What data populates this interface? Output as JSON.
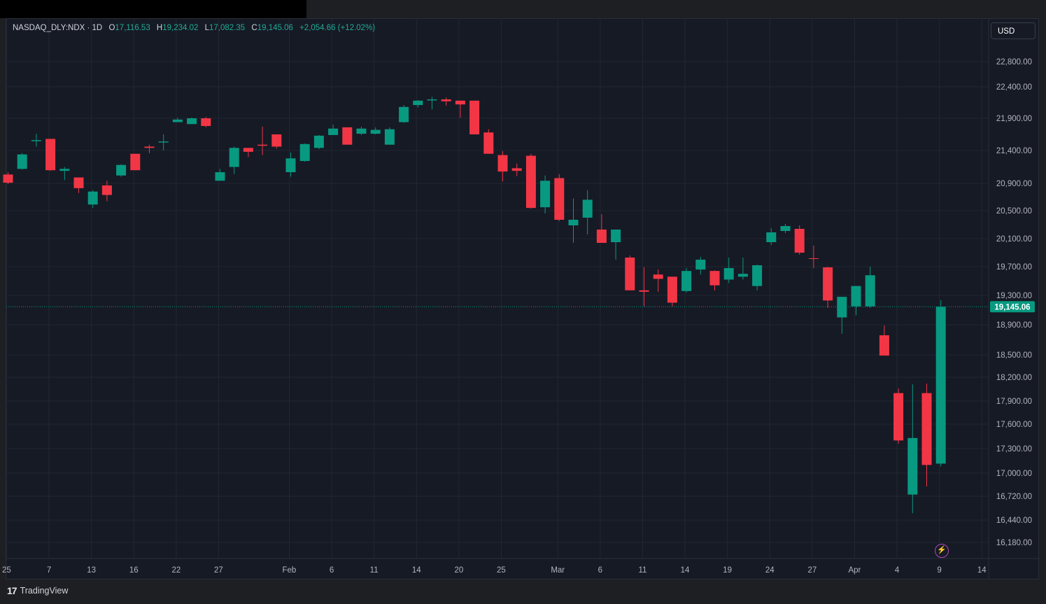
{
  "legend": {
    "symbol": "NASDAQ_DLY:NDX · 1D",
    "open_label": "O",
    "open": "17,116.53",
    "high_label": "H",
    "high": "19,234.02",
    "low_label": "L",
    "low": "17,082.35",
    "close_label": "C",
    "close": "19,145.06",
    "change": "+2,054.66 (+12.02%)"
  },
  "currency_button": "USD",
  "footer": {
    "brand": "TradingView",
    "logo_glyph": "17"
  },
  "colors": {
    "up": "#089981",
    "down": "#f23645",
    "last_price": "#089981",
    "background": "#161a25"
  },
  "icons": {
    "flash": "lightning-icon"
  },
  "flash_glyph": "⚡",
  "chart_data": {
    "type": "candlestick",
    "last_price_label": "19,145.06",
    "last_price": 19145.06,
    "y_ticks": [
      {
        "v": 22800,
        "l": "22,800.00"
      },
      {
        "v": 22400,
        "l": "22,400.00"
      },
      {
        "v": 21900,
        "l": "21,900.00"
      },
      {
        "v": 21400,
        "l": "21,400.00"
      },
      {
        "v": 20900,
        "l": "20,900.00"
      },
      {
        "v": 20500,
        "l": "20,500.00"
      },
      {
        "v": 20100,
        "l": "20,100.00"
      },
      {
        "v": 19700,
        "l": "19,700.00"
      },
      {
        "v": 19300,
        "l": "19,300.00"
      },
      {
        "v": 18900,
        "l": "18,900.00"
      },
      {
        "v": 18500,
        "l": "18,500.00"
      },
      {
        "v": 18200,
        "l": "18,200.00"
      },
      {
        "v": 17900,
        "l": "17,900.00"
      },
      {
        "v": 17600,
        "l": "17,600.00"
      },
      {
        "v": 17300,
        "l": "17,300.00"
      },
      {
        "v": 17000,
        "l": "17,000.00"
      },
      {
        "v": 16720,
        "l": "16,720.00"
      },
      {
        "v": 16440,
        "l": "16,440.00"
      },
      {
        "v": 16180,
        "l": "16,180.00"
      }
    ],
    "x_ticks": [
      {
        "i": -0.3,
        "l": "25"
      },
      {
        "i": 2.7,
        "l": "7"
      },
      {
        "i": 5.7,
        "l": "13"
      },
      {
        "i": 8.7,
        "l": "16"
      },
      {
        "i": 11.7,
        "l": "22"
      },
      {
        "i": 14.7,
        "l": "27"
      },
      {
        "i": 19.7,
        "l": "Feb"
      },
      {
        "i": 22.7,
        "l": "6"
      },
      {
        "i": 25.7,
        "l": "11"
      },
      {
        "i": 28.7,
        "l": "14"
      },
      {
        "i": 31.7,
        "l": "20"
      },
      {
        "i": 34.7,
        "l": "25"
      },
      {
        "i": 38.7,
        "l": "Mar"
      },
      {
        "i": 41.7,
        "l": "6"
      },
      {
        "i": 44.7,
        "l": "11"
      },
      {
        "i": 47.7,
        "l": "14"
      },
      {
        "i": 50.7,
        "l": "19"
      },
      {
        "i": 53.7,
        "l": "24"
      },
      {
        "i": 56.7,
        "l": "27"
      },
      {
        "i": 59.7,
        "l": "Apr"
      },
      {
        "i": 62.7,
        "l": "4"
      },
      {
        "i": 65.7,
        "l": "9"
      },
      {
        "i": 68.7,
        "l": "14"
      }
    ],
    "candles": [
      {
        "o": 21035,
        "h": 21070,
        "l": 20890,
        "c": 20910
      },
      {
        "o": 21120,
        "h": 21360,
        "l": 21110,
        "c": 21340
      },
      {
        "o": 21555,
        "h": 21660,
        "l": 21460,
        "c": 21560
      },
      {
        "o": 21580,
        "h": 21580,
        "l": 21090,
        "c": 21100
      },
      {
        "o": 21090,
        "h": 21150,
        "l": 20950,
        "c": 21120
      },
      {
        "o": 20990,
        "h": 20990,
        "l": 20760,
        "c": 20830
      },
      {
        "o": 20590,
        "h": 20800,
        "l": 20540,
        "c": 20780
      },
      {
        "o": 20870,
        "h": 20940,
        "l": 20640,
        "c": 20730
      },
      {
        "o": 21020,
        "h": 21190,
        "l": 21000,
        "c": 21180
      },
      {
        "o": 21350,
        "h": 21350,
        "l": 21100,
        "c": 21100
      },
      {
        "o": 21460,
        "h": 21490,
        "l": 21360,
        "c": 21440
      },
      {
        "o": 21540,
        "h": 21650,
        "l": 21400,
        "c": 21540
      },
      {
        "o": 21840,
        "h": 21910,
        "l": 21840,
        "c": 21880
      },
      {
        "o": 21810,
        "h": 21910,
        "l": 21810,
        "c": 21900
      },
      {
        "o": 21900,
        "h": 21920,
        "l": 21760,
        "c": 21780
      },
      {
        "o": 20940,
        "h": 21120,
        "l": 20940,
        "c": 21070
      },
      {
        "o": 21150,
        "h": 21460,
        "l": 21040,
        "c": 21440
      },
      {
        "o": 21440,
        "h": 21440,
        "l": 21300,
        "c": 21380
      },
      {
        "o": 21490,
        "h": 21770,
        "l": 21330,
        "c": 21480
      },
      {
        "o": 21650,
        "h": 21650,
        "l": 21430,
        "c": 21460
      },
      {
        "o": 21070,
        "h": 21370,
        "l": 21000,
        "c": 21280
      },
      {
        "o": 21240,
        "h": 21510,
        "l": 21230,
        "c": 21500
      },
      {
        "o": 21440,
        "h": 21640,
        "l": 21420,
        "c": 21630
      },
      {
        "o": 21640,
        "h": 21800,
        "l": 21640,
        "c": 21740
      },
      {
        "o": 21760,
        "h": 21760,
        "l": 21490,
        "c": 21490
      },
      {
        "o": 21660,
        "h": 21770,
        "l": 21640,
        "c": 21740
      },
      {
        "o": 21660,
        "h": 21760,
        "l": 21650,
        "c": 21720
      },
      {
        "o": 21490,
        "h": 21760,
        "l": 21490,
        "c": 21730
      },
      {
        "o": 21840,
        "h": 22110,
        "l": 21830,
        "c": 22080
      },
      {
        "o": 22110,
        "h": 22190,
        "l": 22070,
        "c": 22180
      },
      {
        "o": 22200,
        "h": 22240,
        "l": 22040,
        "c": 22200
      },
      {
        "o": 22200,
        "h": 22230,
        "l": 22100,
        "c": 22170
      },
      {
        "o": 22180,
        "h": 22180,
        "l": 21910,
        "c": 22120
      },
      {
        "o": 22180,
        "h": 22180,
        "l": 21650,
        "c": 21650
      },
      {
        "o": 21680,
        "h": 21730,
        "l": 21380,
        "c": 21350
      },
      {
        "o": 21330,
        "h": 21390,
        "l": 20930,
        "c": 21080
      },
      {
        "o": 21130,
        "h": 21200,
        "l": 21010,
        "c": 21090
      },
      {
        "o": 21320,
        "h": 21350,
        "l": 20530,
        "c": 20540
      },
      {
        "o": 20550,
        "h": 21020,
        "l": 20460,
        "c": 20940
      },
      {
        "o": 20980,
        "h": 21040,
        "l": 20350,
        "c": 20370
      },
      {
        "o": 20290,
        "h": 20680,
        "l": 20040,
        "c": 20370
      },
      {
        "o": 20400,
        "h": 20800,
        "l": 20160,
        "c": 20660
      },
      {
        "o": 20230,
        "h": 20450,
        "l": 20120,
        "c": 20040
      },
      {
        "o": 20050,
        "h": 20230,
        "l": 19800,
        "c": 20230
      },
      {
        "o": 19830,
        "h": 19860,
        "l": 19400,
        "c": 19370
      },
      {
        "o": 19370,
        "h": 19690,
        "l": 19150,
        "c": 19350
      },
      {
        "o": 19590,
        "h": 19660,
        "l": 19350,
        "c": 19530
      },
      {
        "o": 19560,
        "h": 19560,
        "l": 19150,
        "c": 19200
      },
      {
        "o": 19360,
        "h": 19680,
        "l": 19340,
        "c": 19640
      },
      {
        "o": 19660,
        "h": 19840,
        "l": 19590,
        "c": 19800
      },
      {
        "o": 19640,
        "h": 19650,
        "l": 19370,
        "c": 19440
      },
      {
        "o": 19520,
        "h": 19830,
        "l": 19470,
        "c": 19680
      },
      {
        "o": 19560,
        "h": 19830,
        "l": 19520,
        "c": 19600
      },
      {
        "o": 19430,
        "h": 19730,
        "l": 19370,
        "c": 19720
      },
      {
        "o": 20050,
        "h": 20250,
        "l": 20010,
        "c": 20190
      },
      {
        "o": 20210,
        "h": 20310,
        "l": 20180,
        "c": 20280
      },
      {
        "o": 20240,
        "h": 20290,
        "l": 19870,
        "c": 19900
      },
      {
        "o": 19820,
        "h": 20000,
        "l": 19680,
        "c": 19810
      },
      {
        "o": 19690,
        "h": 19700,
        "l": 19130,
        "c": 19230
      },
      {
        "o": 19000,
        "h": 19280,
        "l": 18780,
        "c": 19280
      },
      {
        "o": 19150,
        "h": 19430,
        "l": 19030,
        "c": 19430
      },
      {
        "o": 19150,
        "h": 19700,
        "l": 19130,
        "c": 19580
      },
      {
        "o": 18760,
        "h": 18890,
        "l": 18500,
        "c": 18490
      },
      {
        "o": 18000,
        "h": 18060,
        "l": 17360,
        "c": 17400
      },
      {
        "o": 16740,
        "h": 18110,
        "l": 16520,
        "c": 17430
      },
      {
        "o": 18000,
        "h": 18120,
        "l": 16840,
        "c": 17100
      },
      {
        "o": 17116.53,
        "h": 19234.02,
        "l": 17082.35,
        "c": 19145.06
      }
    ]
  }
}
